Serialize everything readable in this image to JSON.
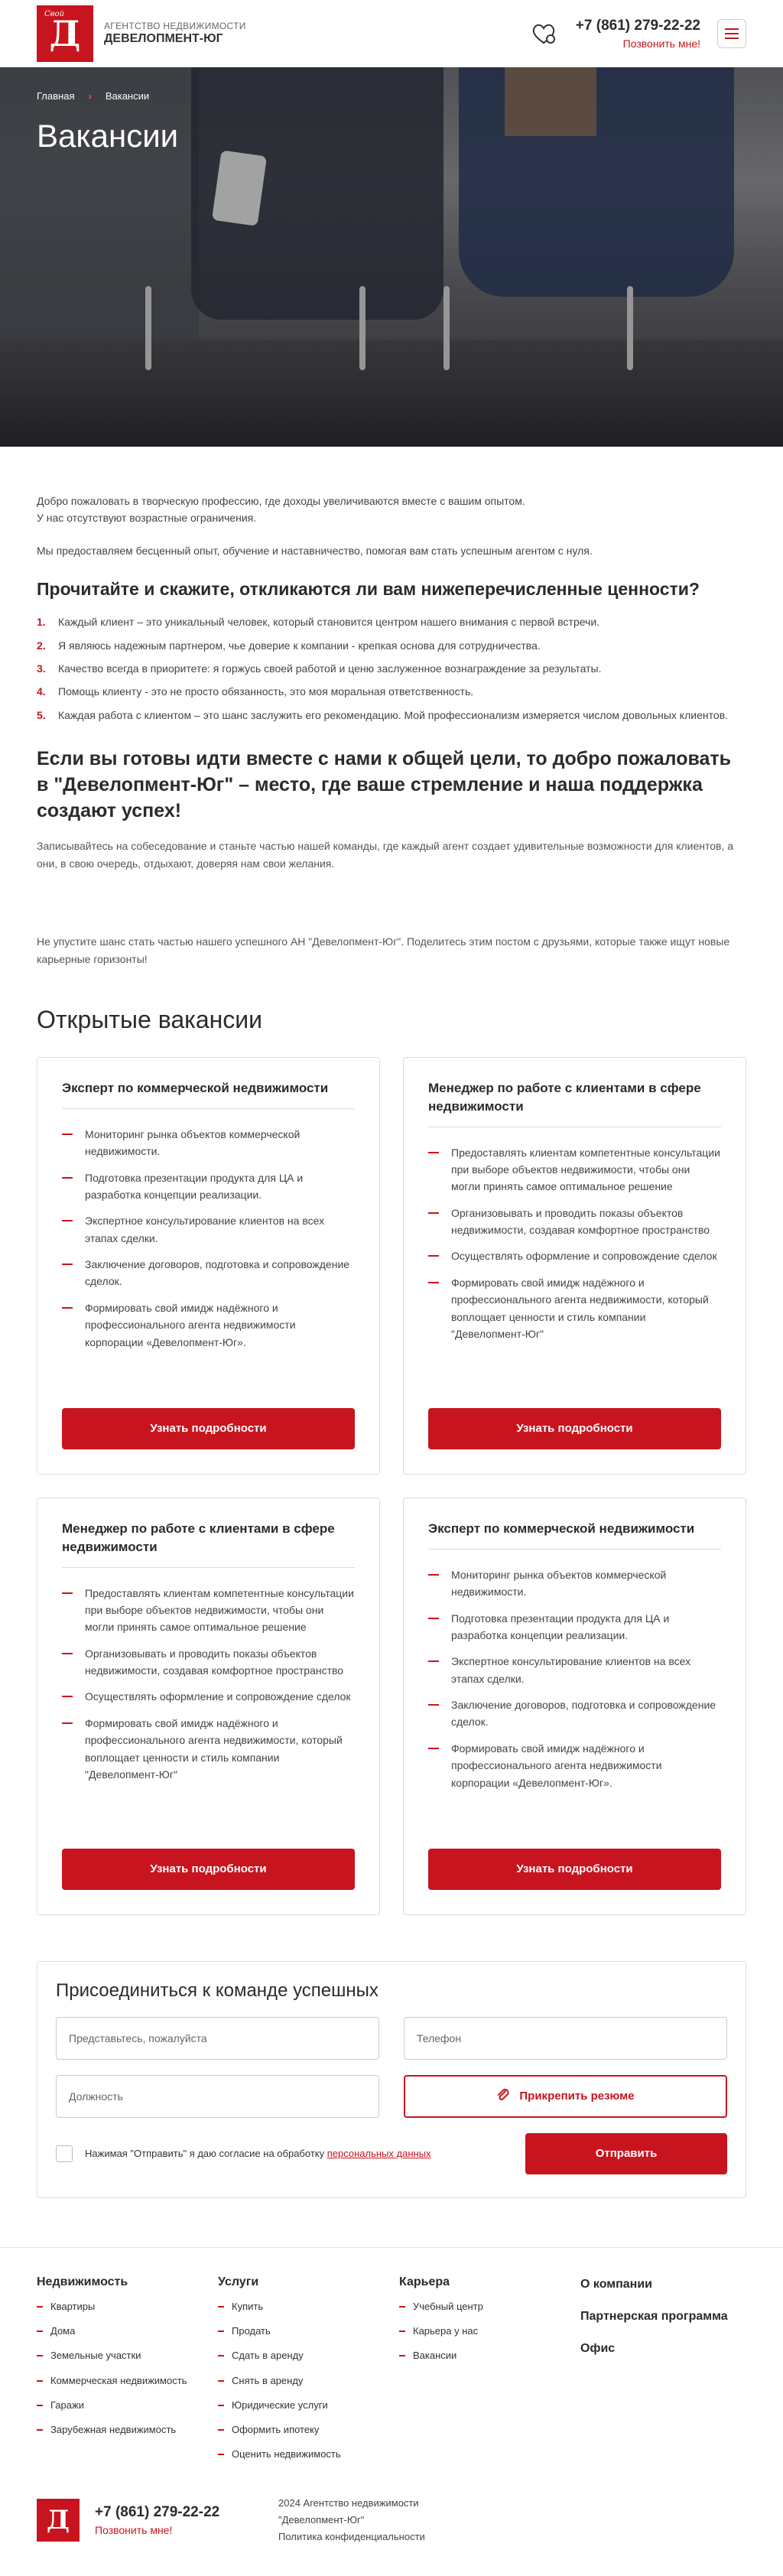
{
  "header": {
    "logo_small": "Свой",
    "logo_letter": "Д",
    "brand_line1": "Агентство недвижимости",
    "brand_line2": "Девелопмент-Юг",
    "phone": "+7 (861) 279-22-22",
    "callback": "Позвонить мне!"
  },
  "hero": {
    "crumb_home": "Главная",
    "crumb_current": "Вакансии",
    "title": "Вакансии"
  },
  "intro": {
    "p1": "Добро пожаловать в творческую профессию, где доходы увеличиваются вместе с вашим опытом.",
    "p2": "У нас отсутствуют возрастные ограничения.",
    "p3": "Мы предоставляем бесценный опыт, обучение и наставничество, помогая вам стать успешным агентом с нуля."
  },
  "values": {
    "heading": "Прочитайте и скажите, откликаются ли вам нижеперечисленные ценности?",
    "items": [
      {
        "n": "1.",
        "text": "Каждый клиент – это уникальный человек, который становится центром нашего внимания с первой встречи."
      },
      {
        "n": "2.",
        "text": "Я являюсь надежным партнером, чье доверие к компании - крепкая основа для сотрудничества."
      },
      {
        "n": "3.",
        "text": "Качество всегда в приоритете: я горжусь своей работой и ценю заслуженное вознаграждение за результаты."
      },
      {
        "n": "4.",
        "text": "Помощь клиенту - это не просто обязанность, это моя моральная ответственность."
      },
      {
        "n": "5.",
        "text": "Каждая работа с клиентом – это шанс заслужить его рекомендацию. Мой профессионализм измеряется числом довольных клиентов."
      }
    ]
  },
  "join": {
    "heading": "Если вы готовы идти вместе с нами к общей цели, то добро пожаловать в \"Девелопмент-Юг\" – место, где ваше стремление и наша поддержка создают успех!",
    "desc": "Записывайтесь на собеседование и станьте частью нашей команды, где каждый агент создает удивительные возможности для клиентов, а они, в свою очередь, отдыхают, доверяя нам свои желания.",
    "share": "Не упустите шанс стать частью нашего успешного АН \"Девелопмент-Юг\". Поделитесь этим постом с друзьями, которые также ищут новые карьерные горизонты!"
  },
  "vacancies": {
    "heading": "Открытые вакансии",
    "button_label": "Узнать подробности",
    "cards": [
      {
        "title": "Эксперт по коммерческой недвижимости",
        "items": [
          "Мониторинг рынка объектов коммерческой недвижимости.",
          "Подготовка презентации продукта для ЦА и разработка концепции реализации.",
          "Экспертное консультирование клиентов на всех этапах сделки.",
          "Заключение договоров, подготовка и сопровождение сделок.",
          "Формировать свой имидж надёжного и профессионального агента недвижимости корпорации «Девелопмент-Юг»."
        ]
      },
      {
        "title": "Менеджер по работе с клиентами в сфере недвижимости",
        "items": [
          "Предоставлять клиентам компетентные консультации при выборе объектов недвижимости, чтобы они могли принять самое оптимальное решение",
          "Организовывать и проводить показы объектов недвижимости, создавая комфортное пространство",
          "Осуществлять оформление и сопровождение сделок",
          "Формировать свой имидж надёжного и профессионального агента недвижимости, который воплощает ценности и стиль компании \"Девелопмент-Юг\""
        ]
      },
      {
        "title": "Менеджер по работе с клиентами в сфере недвижимости",
        "items": [
          "Предоставлять клиентам компетентные консультации при выборе объектов недвижимости, чтобы они могли принять самое оптимальное решение",
          "Организовывать и проводить показы объектов недвижимости, создавая комфортное пространство",
          "Осуществлять оформление и сопровождение сделок",
          "Формировать свой имидж надёжного и профессионального агента недвижимости, который воплощает ценности и стиль компании \"Девелопмент-Юг\""
        ]
      },
      {
        "title": "Эксперт по коммерческой недвижимости",
        "items": [
          "Мониторинг рынка объектов коммерческой недвижимости.",
          "Подготовка презентации продукта для ЦА и разработка концепции реализации.",
          "Экспертное консультирование клиентов на всех этапах сделки.",
          "Заключение договоров, подготовка и сопровождение сделок.",
          "Формировать свой имидж надёжного и профессионального агента недвижимости корпорации «Девелопмент-Юг»."
        ]
      }
    ]
  },
  "form": {
    "title": "Присоединиться к команде успешных",
    "name_placeholder": "Представьтесь, пожалуйста",
    "phone_placeholder": "Телефон",
    "position_placeholder": "Должность",
    "attach_label": "Прикрепить резюме",
    "consent_text": "Нажимая \"Отправить\" я даю согласие на обработку ",
    "consent_link": "персональных данных",
    "submit_label": "Отправить"
  },
  "footer": {
    "col1": {
      "title": "Недвижимость",
      "items": [
        "Квартиры",
        "Дома",
        "Земельные участки",
        "Коммерческая недвижимость",
        "Гаражи",
        "Зарубежная недвижимость"
      ]
    },
    "col2": {
      "title": "Услуги",
      "items": [
        "Купить",
        "Продать",
        "Сдать в аренду",
        "Снять в аренду",
        "Юридические услуги",
        "Оформить ипотеку",
        "Оценить недвижимость"
      ]
    },
    "col3": {
      "title": "Карьера",
      "items": [
        "Учебный центр",
        "Карьера у нас",
        "Вакансии"
      ]
    },
    "col4": {
      "items": [
        "О компании",
        "Партнерская программа",
        "Офис"
      ]
    },
    "phone": "+7 (861) 279-22-22",
    "callback": "Позвонить мне!",
    "copy1": "2024 Агентство недвижимости",
    "copy2": "\"Девелопмент-Юг\"",
    "privacy": "Политика конфиденциальности"
  },
  "colors": {
    "accent": "#c8141e"
  }
}
